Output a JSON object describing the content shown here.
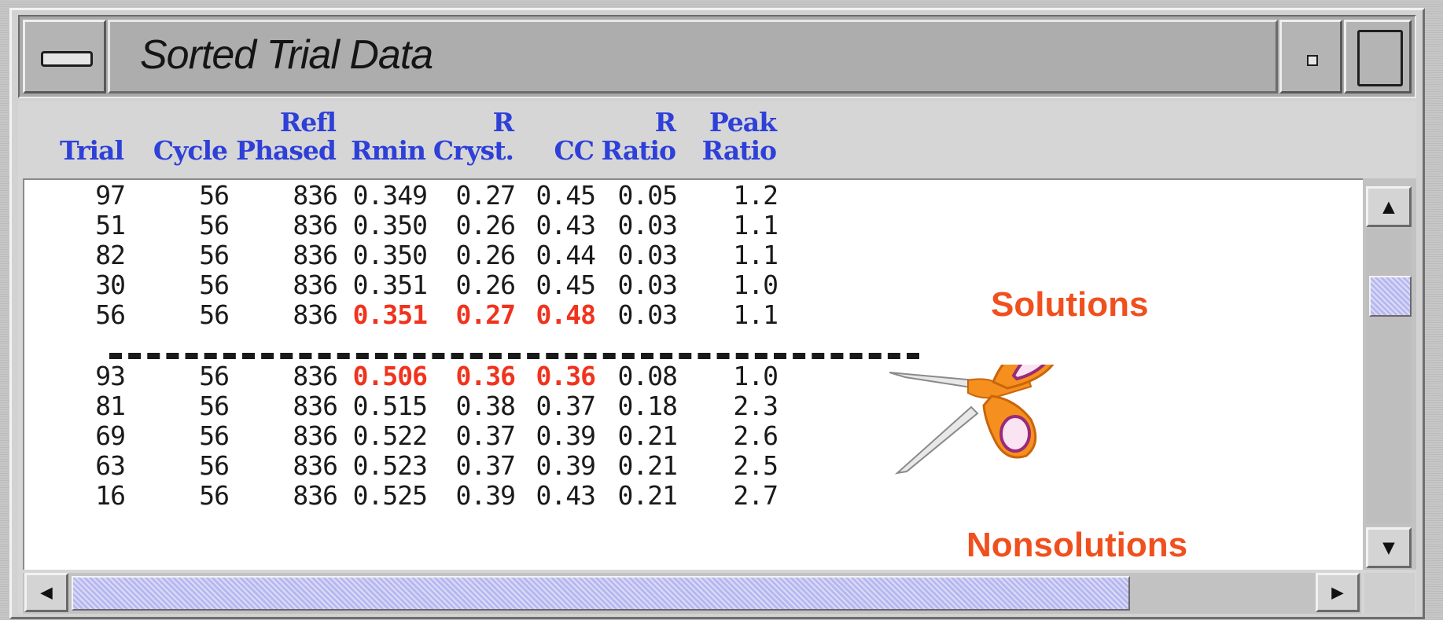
{
  "window": {
    "title": "Sorted Trial Data"
  },
  "columns": [
    {
      "line1": "",
      "line2": "Trial"
    },
    {
      "line1": "",
      "line2": "Cycle"
    },
    {
      "line1": "Refl",
      "line2": "Phased"
    },
    {
      "line1": "",
      "line2": "Rmin"
    },
    {
      "line1": "R",
      "line2": "Cryst."
    },
    {
      "line1": "",
      "line2": "CC"
    },
    {
      "line1": "R",
      "line2": "Ratio"
    },
    {
      "line1": "Peak",
      "line2": "Ratio"
    }
  ],
  "rows": [
    {
      "cells": [
        "97",
        "56",
        "836",
        "0.349",
        "0.27",
        "0.45",
        "0.05",
        "1.2"
      ],
      "highlight": []
    },
    {
      "cells": [
        "51",
        "56",
        "836",
        "0.350",
        "0.26",
        "0.43",
        "0.03",
        "1.1"
      ],
      "highlight": []
    },
    {
      "cells": [
        "82",
        "56",
        "836",
        "0.350",
        "0.26",
        "0.44",
        "0.03",
        "1.1"
      ],
      "highlight": []
    },
    {
      "cells": [
        "30",
        "56",
        "836",
        "0.351",
        "0.26",
        "0.45",
        "0.03",
        "1.0"
      ],
      "highlight": []
    },
    {
      "cells": [
        "56",
        "56",
        "836",
        "0.351",
        "0.27",
        "0.48",
        "0.03",
        "1.1"
      ],
      "highlight": [
        3,
        4,
        5
      ]
    },
    {
      "cells": [
        "93",
        "56",
        "836",
        "0.506",
        "0.36",
        "0.36",
        "0.08",
        "1.0"
      ],
      "highlight": [
        3,
        4,
        5
      ]
    },
    {
      "cells": [
        "81",
        "56",
        "836",
        "0.515",
        "0.38",
        "0.37",
        "0.18",
        "2.3"
      ],
      "highlight": []
    },
    {
      "cells": [
        "69",
        "56",
        "836",
        "0.522",
        "0.37",
        "0.39",
        "0.21",
        "2.6"
      ],
      "highlight": []
    },
    {
      "cells": [
        "63",
        "56",
        "836",
        "0.523",
        "0.37",
        "0.39",
        "0.21",
        "2.5"
      ],
      "highlight": []
    },
    {
      "cells": [
        "16",
        "56",
        "836",
        "0.525",
        "0.39",
        "0.43",
        "0.21",
        "2.7"
      ],
      "highlight": []
    }
  ],
  "annotations": {
    "solutions_label": "Solutions",
    "nonsolutions_label": "Nonsolutions",
    "cut_icon": "scissors-icon",
    "highlight_color": "#f0331d",
    "label_color": "#f0501e",
    "header_color": "#2e40d8"
  },
  "icons": {
    "window_menu": "window-menu-icon",
    "minimize": "minimize-icon",
    "maximize": "maximize-icon",
    "scroll_up": "▲",
    "scroll_down": "▼",
    "scroll_left": "◀",
    "scroll_right": "▶"
  }
}
